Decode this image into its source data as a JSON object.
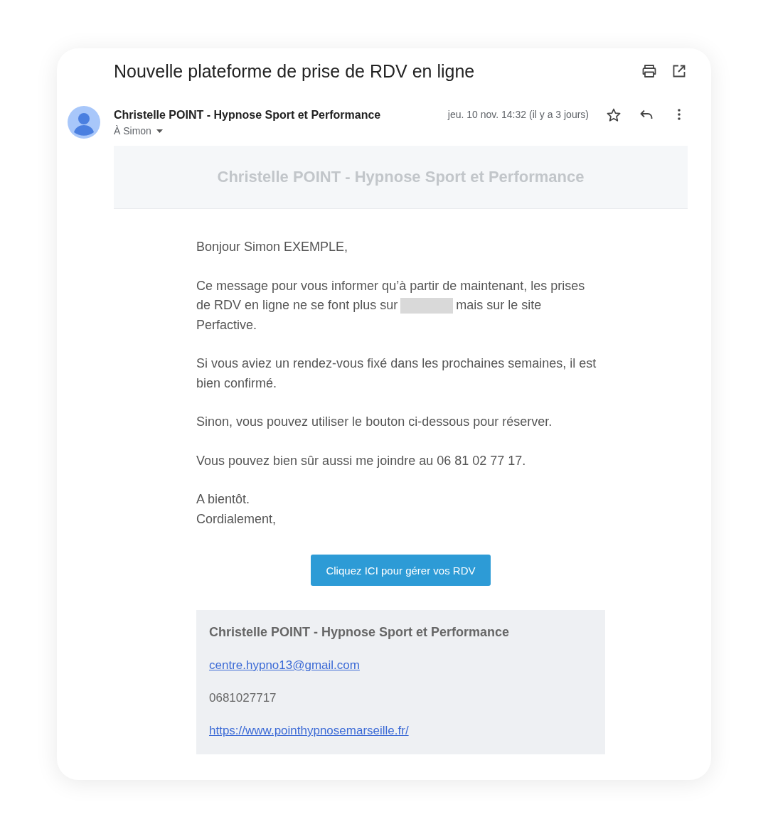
{
  "email": {
    "subject": "Nouvelle plateforme de prise de RDV en ligne",
    "sender": "Christelle POINT - Hypnose Sport et Performance",
    "recipient": "À Simon",
    "date": "jeu. 10 nov. 14:32 (il y a 3 jours)",
    "starred": false
  },
  "banner": {
    "title": "Christelle POINT - Hypnose Sport et Performance"
  },
  "body": {
    "paragraphs": [
      {
        "kind": "text",
        "text": "Bonjour Simon EXEMPLE,"
      },
      {
        "kind": "mixed",
        "lines": [
          [
            {
              "kind": "text",
              "text": "Ce message pour vous informer qu’à partir de maintenant, les prises"
            }
          ],
          [
            {
              "kind": "text",
              "text": "de RDV en ligne ne se font plus sur"
            },
            {
              "kind": "redacted"
            },
            {
              "kind": "text",
              "text": "mais sur le site"
            }
          ],
          [
            {
              "kind": "text",
              "text": "Perfactive."
            }
          ]
        ]
      },
      {
        "kind": "text",
        "text": "Si vous aviez un rendez-vous fixé dans les prochaines semaines, il est bien confirmé."
      },
      {
        "kind": "text",
        "text": "Sinon, vous pouvez utiliser le bouton ci-dessous pour réserver."
      },
      {
        "kind": "text",
        "text": "Vous pouvez bien sûr aussi me joindre au 06 81 02 77 17."
      },
      {
        "kind": "lines",
        "lines": [
          "A bientôt.",
          "Cordialement,"
        ]
      }
    ]
  },
  "button": {
    "label": "Cliquez ICI pour gérer vos RDV"
  },
  "signature": {
    "name": "Christelle POINT - Hypnose Sport et Performance",
    "email": "centre.hypno13@gmail.com",
    "phone": "0681027717",
    "website": "https://www.pointhypnosemarseille.fr/"
  }
}
